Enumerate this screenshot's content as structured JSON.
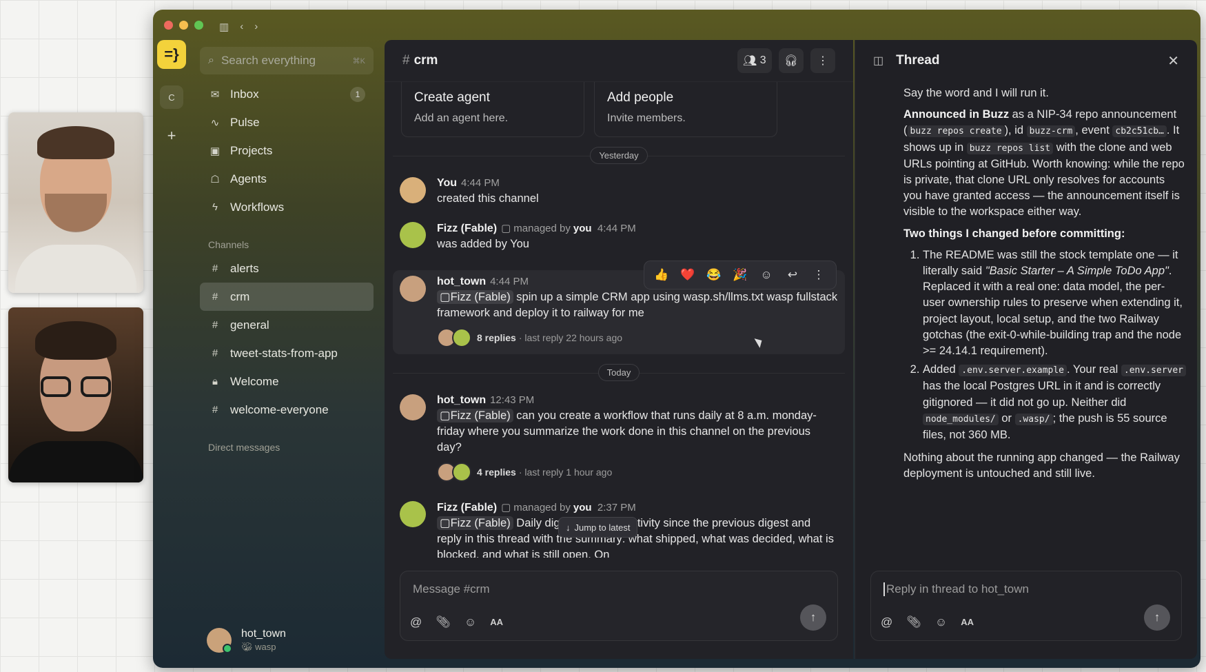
{
  "sidebar": {
    "search_placeholder": "Search everything",
    "search_shortcut": "⌘K",
    "nav": [
      {
        "label": "Inbox",
        "badge": "1"
      },
      {
        "label": "Pulse"
      },
      {
        "label": "Projects"
      },
      {
        "label": "Agents"
      },
      {
        "label": "Workflows"
      }
    ],
    "channels_label": "Channels",
    "channels": [
      "alerts",
      "crm",
      "general",
      "tweet-stats-from-app",
      "Welcome",
      "welcome-everyone"
    ],
    "active_channel": "crm",
    "dm_label": "Direct messages",
    "user": {
      "name": "hot_town",
      "workspace": "wasp"
    }
  },
  "rail": {
    "workspace_letter": "C"
  },
  "channel": {
    "name": "crm",
    "member_count": "3",
    "cards": [
      {
        "title": "Create agent",
        "subtitle": "Add an agent here."
      },
      {
        "title": "Add people",
        "subtitle": "Invite members."
      }
    ],
    "day_yesterday": "Yesterday",
    "day_today": "Today",
    "messages": [
      {
        "author": "You",
        "time": "4:44 PM",
        "text": "created this channel"
      },
      {
        "author": "Fizz (Fable)",
        "managed_by": "managed by",
        "manager": "you",
        "time": "4:44 PM",
        "text": "was added by You"
      },
      {
        "author": "hot_town",
        "time": "4:44 PM",
        "mention": "Fizz (Fable)",
        "text": "spin up a simple CRM app using wasp.sh/llms.txt wasp fullstack framework and deploy it to railway for me",
        "replies": "8 replies",
        "last_reply": "· last reply 22 hours ago"
      },
      {
        "author": "hot_town",
        "time": "12:43 PM",
        "mention": "Fizz (Fable)",
        "text": "can you create a workflow that runs daily at 8 a.m. monday-friday where you summarize the work done in this channel on the previous day?",
        "replies": "4 replies",
        "last_reply": "· last reply 1 hour ago"
      },
      {
        "author": "Fizz (Fable)",
        "managed_by": "managed by",
        "manager": "you",
        "time": "2:37 PM",
        "mention": "Fizz (Fable)",
        "text": "Daily dig… channel's activity since the previous digest and reply in this thread with the summary: what shipped, what was decided, what is blocked, and what is still open. On"
      }
    ],
    "reactions": [
      "👍",
      "❤️",
      "😂",
      "🎉"
    ],
    "jump_label": "Jump to latest",
    "composer_placeholder": "Message #crm",
    "format_label": "AA"
  },
  "thread": {
    "title": "Thread",
    "p1": "Say the word and I will run it.",
    "p2_bold": "Announced in Buzz",
    "p2_a": " as a NIP-34 repo announcement (",
    "p2_code1": "buzz repos create",
    "p2_b": "), id ",
    "p2_code2": "buzz-crm",
    "p2_c": ", event ",
    "p2_code3": "cb2c51cb…",
    "p2_d": ". It shows up in ",
    "p2_code4": "buzz repos list",
    "p2_e": " with the clone and web URLs pointing at GitHub. Worth knowing: while the repo is private, that clone URL only resolves for accounts you have granted access — the announcement itself is visible to the workspace either way.",
    "h1": "Two things I changed before committing:",
    "li1_a": "The README was still the stock template one — it literally said ",
    "li1_em": "\"Basic Starter – A Simple ToDo App\"",
    "li1_b": ". Replaced it with a real one: data model, the per-user ownership rules to preserve when extending it, project layout, local setup, and the two Railway gotchas (the exit-0-while-building trap and the node >= 24.14.1 requirement).",
    "li2_a": "Added ",
    "li2_code1": ".env.server.example",
    "li2_b": ". Your real ",
    "li2_code2": ".env.server",
    "li2_c": " has the local Postgres URL in it and is correctly gitignored — it did not go up. Neither did ",
    "li2_code3": "node_modules/",
    "li2_d": " or ",
    "li2_code4": ".wasp/",
    "li2_e": "; the push is 55 source files, not 360 MB.",
    "p3": "Nothing about the running app changed — the Railway deployment is untouched and still live.",
    "composer_placeholder": "Reply in thread to hot_town",
    "format_label": "AA"
  },
  "colors": {
    "logo": "#f3d23b",
    "online": "#3ec46d"
  },
  "icons": [
    "search-icon",
    "inbox-icon",
    "pulse-icon",
    "projects-icon",
    "agents-icon",
    "workflows-icon",
    "hash-icon",
    "lock-icon",
    "people-icon",
    "headphones-icon",
    "more-icon",
    "close-icon",
    "at-icon",
    "attach-icon",
    "emoji-icon",
    "send-icon",
    "thread-panel-icon"
  ]
}
